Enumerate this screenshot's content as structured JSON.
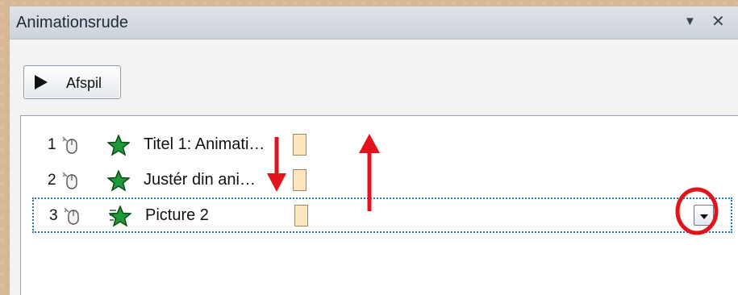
{
  "pane": {
    "title": "Animationsrude",
    "menu_icon": "▼",
    "close_icon": "✕"
  },
  "toolbar": {
    "play_label": "Afspil",
    "play_icon": "play-icon"
  },
  "animation_list": [
    {
      "number": "1",
      "trigger_icon": "mouse-click-icon",
      "effect_icon": "star-entrance-icon",
      "name": "Titel 1: Animati…",
      "selected": false
    },
    {
      "number": "2",
      "trigger_icon": "mouse-click-icon",
      "effect_icon": "star-entrance-icon",
      "name": "Justér din ani…",
      "selected": false
    },
    {
      "number": "3",
      "trigger_icon": "mouse-click-icon",
      "effect_icon": "star-effect-icon",
      "name": "Picture 2",
      "selected": true
    }
  ],
  "annotation_colors": {
    "arrows": "#e3131b",
    "circle": "#e3131b",
    "selection": "#1e78c8"
  }
}
